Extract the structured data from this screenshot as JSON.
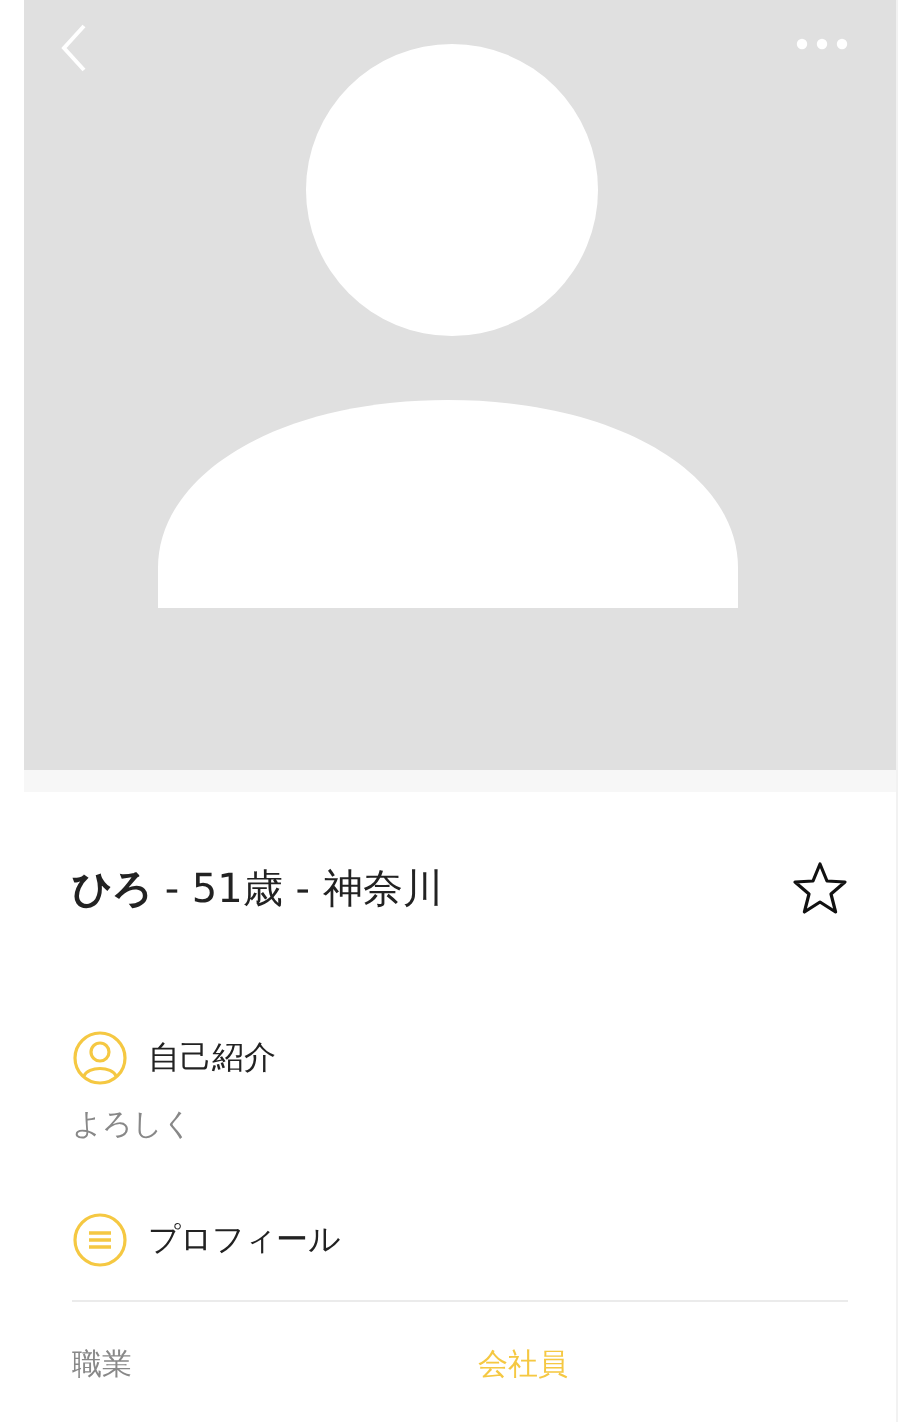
{
  "profile": {
    "name_line": "**ひろ** - 51歳 - 神奈川",
    "favorite": false
  },
  "sections": [
    {
      "kind": "intro",
      "title": "自己紹介",
      "body": "よろしく"
    },
    {
      "kind": "profile",
      "title": "プロフィール",
      "rows": [
        {
          "label": "職業",
          "value": "会社員"
        }
      ]
    }
  ]
}
